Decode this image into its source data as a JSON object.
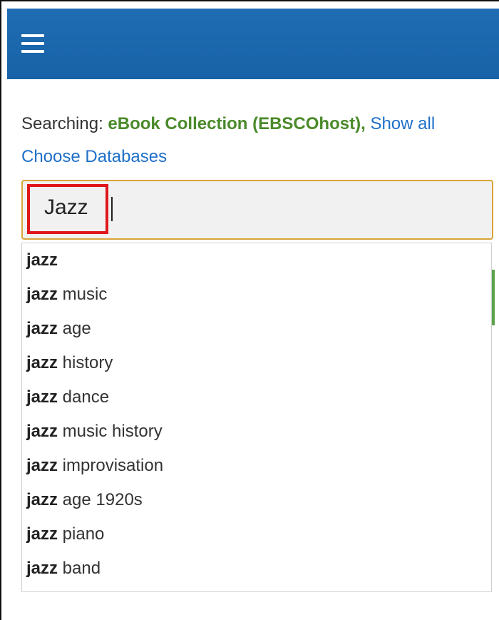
{
  "header": {
    "menu_icon": "hamburger-menu-icon",
    "color": "#1f6db3"
  },
  "search_context": {
    "prefix": "Searching: ",
    "database": "eBook Collection (EBSCOhost),",
    "show_all": "Show all",
    "choose_databases": "Choose Databases"
  },
  "search": {
    "value": "Jazz",
    "highlight_color": "#e0161b",
    "border_color": "#d9a33a"
  },
  "suggestions": [
    {
      "bold": "jazz",
      "rest": ""
    },
    {
      "bold": "jazz",
      "rest": " music"
    },
    {
      "bold": "jazz",
      "rest": " age"
    },
    {
      "bold": "jazz",
      "rest": " history"
    },
    {
      "bold": "jazz",
      "rest": " dance"
    },
    {
      "bold": "jazz",
      "rest": " music history"
    },
    {
      "bold": "jazz",
      "rest": " improvisation"
    },
    {
      "bold": "jazz",
      "rest": " age 1920s"
    },
    {
      "bold": "jazz",
      "rest": " piano"
    },
    {
      "bold": "jazz",
      "rest": " band"
    }
  ]
}
